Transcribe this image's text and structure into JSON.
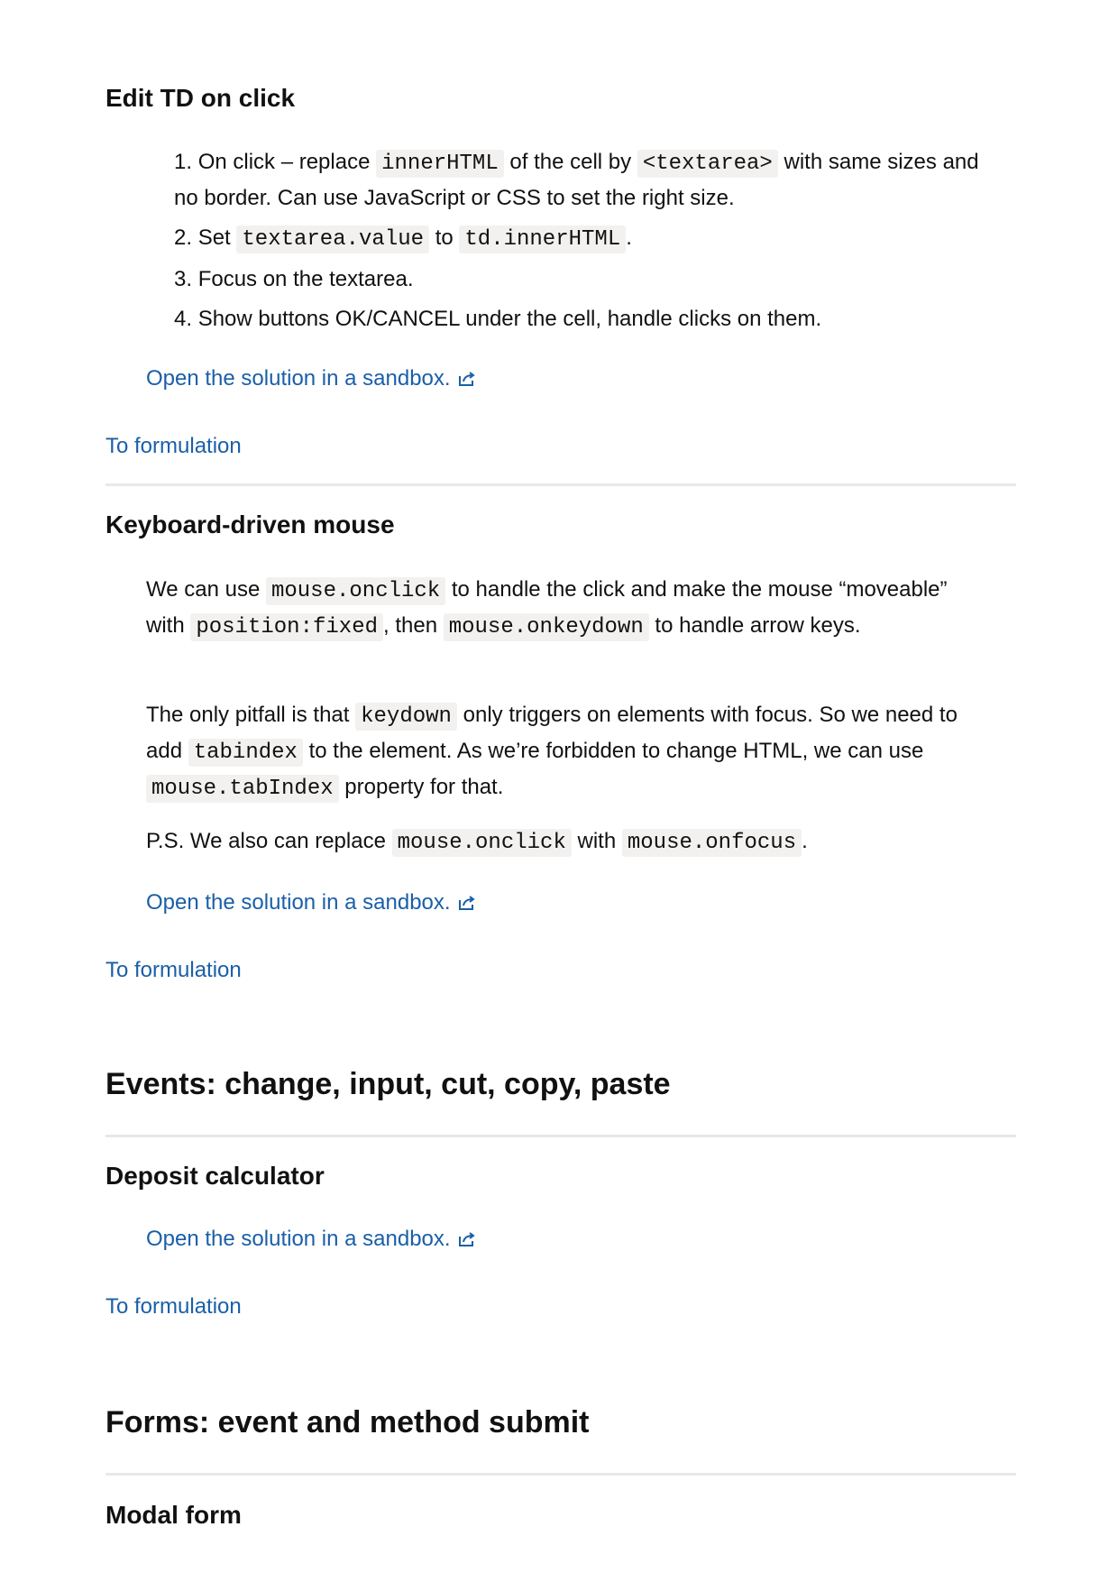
{
  "task1": {
    "title": "Edit TD on click",
    "steps": [
      {
        "num": "1.",
        "t1": "On click – replace ",
        "c1": "innerHTML",
        "t2": " of the cell by ",
        "c2": "<textarea>",
        "t3": " with same sizes and no border. Can use JavaScript or CSS to set the right size."
      },
      {
        "num": "2.",
        "t1": "Set ",
        "c1": "textarea.value",
        "t2": " to ",
        "c2": "td.innerHTML",
        "t3": "."
      },
      {
        "num": "3.",
        "t1": "Focus on the textarea."
      },
      {
        "num": "4.",
        "t1": "Show buttons OK/CANCEL under the cell, handle clicks on them."
      }
    ],
    "sandbox_link": "Open the solution in a sandbox.",
    "formulation_link": "To formulation"
  },
  "task2": {
    "title": "Keyboard-driven mouse",
    "p1": {
      "t1": "We can use ",
      "c1": "mouse.onclick",
      "t2": " to handle the click and make the mouse “moveable” with ",
      "c2": "position:fixed",
      "t3": ", then ",
      "c3": "mouse.onkeydown",
      "t4": " to handle arrow keys."
    },
    "p2": {
      "t1": "The only pitfall is that ",
      "c1": "keydown",
      "t2": " only triggers on elements with focus. So we need to add ",
      "c2": "tabindex",
      "t3": " to the element. As we’re forbidden to change HTML, we can use ",
      "c3": "mouse.tabIndex",
      "t4": " property for that."
    },
    "p3": {
      "t1": "P.S. We also can replace ",
      "c1": "mouse.onclick",
      "t2": " with ",
      "c2": "mouse.onfocus",
      "t3": "."
    },
    "sandbox_link": "Open the solution in a sandbox.",
    "formulation_link": "To formulation"
  },
  "section1": {
    "title": "Events: change, input, cut, copy, paste"
  },
  "task3": {
    "title": "Deposit calculator",
    "sandbox_link": "Open the solution in a sandbox.",
    "formulation_link": "To formulation"
  },
  "section2": {
    "title": "Forms: event and method submit"
  },
  "task4": {
    "title": "Modal form"
  },
  "colors": {
    "link": "#1a5fa8",
    "code_bg": "#f3f1ef",
    "rule": "#e8e8e8"
  }
}
